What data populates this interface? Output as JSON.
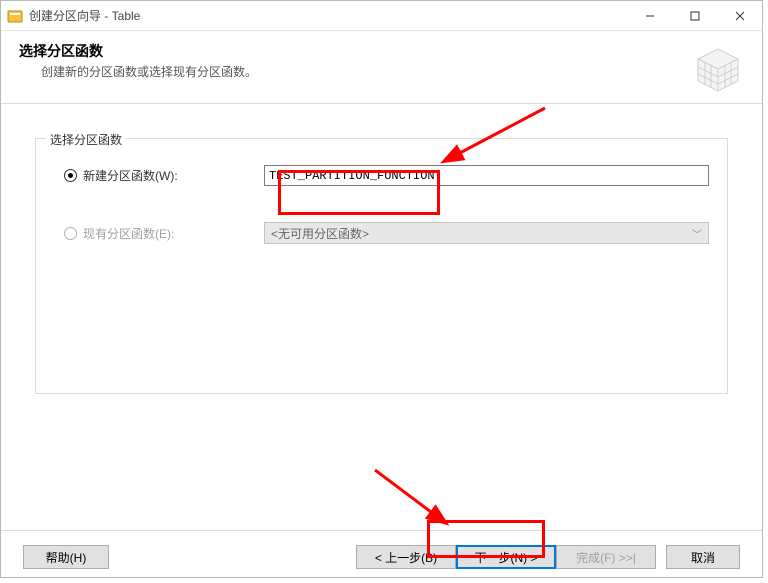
{
  "window": {
    "title": "创建分区向导 - Table",
    "min": "—",
    "max": "☐",
    "close": "✕"
  },
  "header": {
    "title": "选择分区函数",
    "subtitle": "创建新的分区函数或选择现有分区函数。"
  },
  "group": {
    "title": "选择分区函数",
    "new_radio_label": "新建分区函数(W):",
    "existing_radio_label": "现有分区函数(E):",
    "new_value": "TEST_PARTITION_FUNCTION",
    "existing_placeholder": "<无可用分区函数>"
  },
  "buttons": {
    "help": "帮助(H)",
    "back": "< 上一步(B)",
    "next": "下一步(N) >",
    "finish": "完成(F) >>|",
    "cancel": "取消"
  }
}
